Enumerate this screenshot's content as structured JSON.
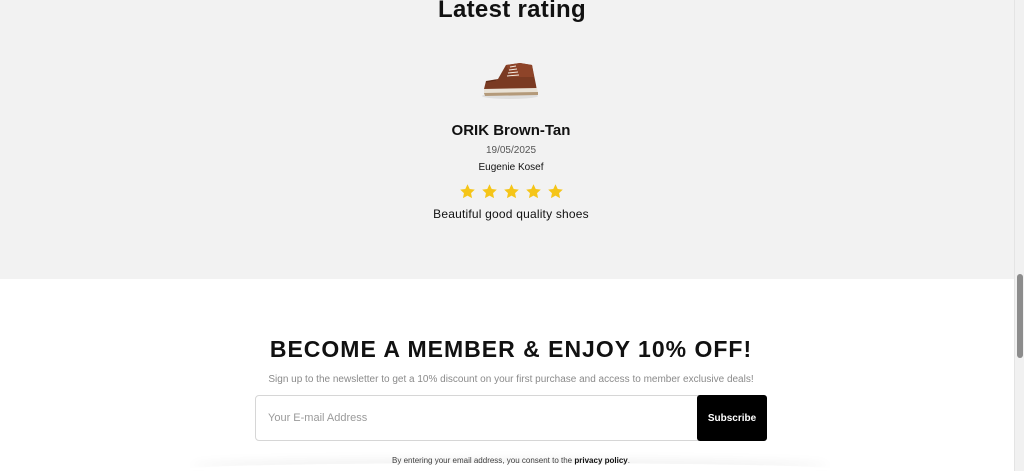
{
  "rating": {
    "title": "Latest rating",
    "product_name": "ORIK Brown-Tan",
    "date": "19/05/2025",
    "reviewer": "Eugenie Kosef",
    "stars": 5,
    "star_color": "#f5c518",
    "review_text": "Beautiful good quality shoes",
    "product_image": "brown-high-top-sneaker-icon"
  },
  "newsletter": {
    "title": "BECOME A MEMBER & ENJOY 10% OFF!",
    "subtitle": "Sign up to the newsletter to get a 10% discount on your first purchase and access to member exclusive deals!",
    "email_placeholder": "Your E-mail Address",
    "subscribe_label": "Subscribe",
    "consent_prefix": "By entering your email address, you consent to the",
    "consent_link": "privacy policy",
    "consent_suffix": "."
  }
}
